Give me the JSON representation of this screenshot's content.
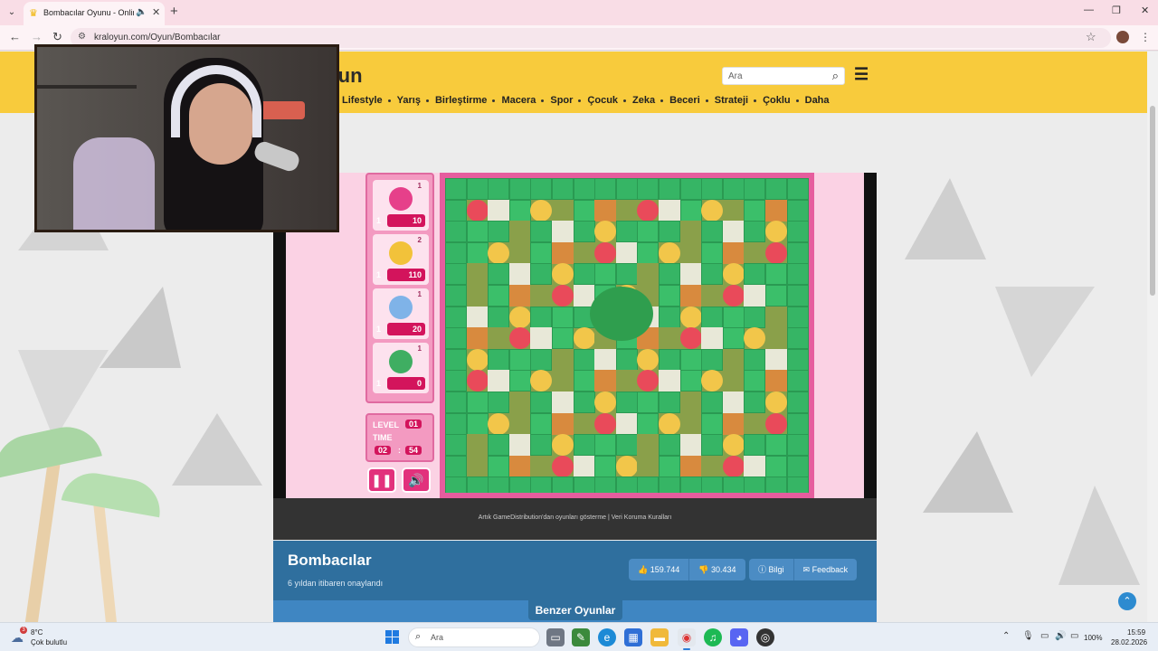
{
  "browser": {
    "tab_title": "Bombacılar Oyunu - Online",
    "url": "kraloyun.com/Oyun/Bombacılar",
    "new_tab": "+",
    "controls": {
      "minimize": "—",
      "restore": "❐",
      "close": "✕"
    }
  },
  "site": {
    "logo": "oyun",
    "search_placeholder": "Ara",
    "categories": [
      "Lifestyle",
      "Yarış",
      "Birleştirme",
      "Macera",
      "Spor",
      "Çocuk",
      "Zeka",
      "Beceri",
      "Strateji",
      "Çoklu",
      "Daha"
    ]
  },
  "game": {
    "players": [
      {
        "rank": "1",
        "lives": "1",
        "score": "10",
        "color": "#e6408a"
      },
      {
        "rank": "2",
        "lives": "1",
        "score": "110",
        "color": "#f2c23a"
      },
      {
        "rank": "1",
        "lives": "1",
        "score": "20",
        "color": "#7fb3e8"
      },
      {
        "rank": "1",
        "lives": "1",
        "score": "0",
        "color": "#3fae62"
      }
    ],
    "level_label": "LEVEL",
    "level_value": "01",
    "time_label": "TIME",
    "time_min": "02",
    "time_sep": ":",
    "time_sec": "54",
    "pause_icon": "❚❚",
    "sound_icon": "🔊"
  },
  "info": {
    "notice": "Artık GameDistribution'dan oyunları gösterme | Veri Koruma Kuralları",
    "title": "Bombacılar",
    "subtitle": "6 yıldan itibaren onaylandı",
    "likes": "159.744",
    "dislikes": "30.434",
    "info_label": "Bilgi",
    "feedback_label": "Feedback",
    "similar": "Benzer Oyunlar"
  },
  "taskbar": {
    "weather_badge": "3",
    "temperature": "8°C",
    "weather_desc": "Çok bulutlu",
    "search_placeholder": "Ara",
    "battery": "100%",
    "time": "15:59",
    "date": "28.02.2026"
  }
}
